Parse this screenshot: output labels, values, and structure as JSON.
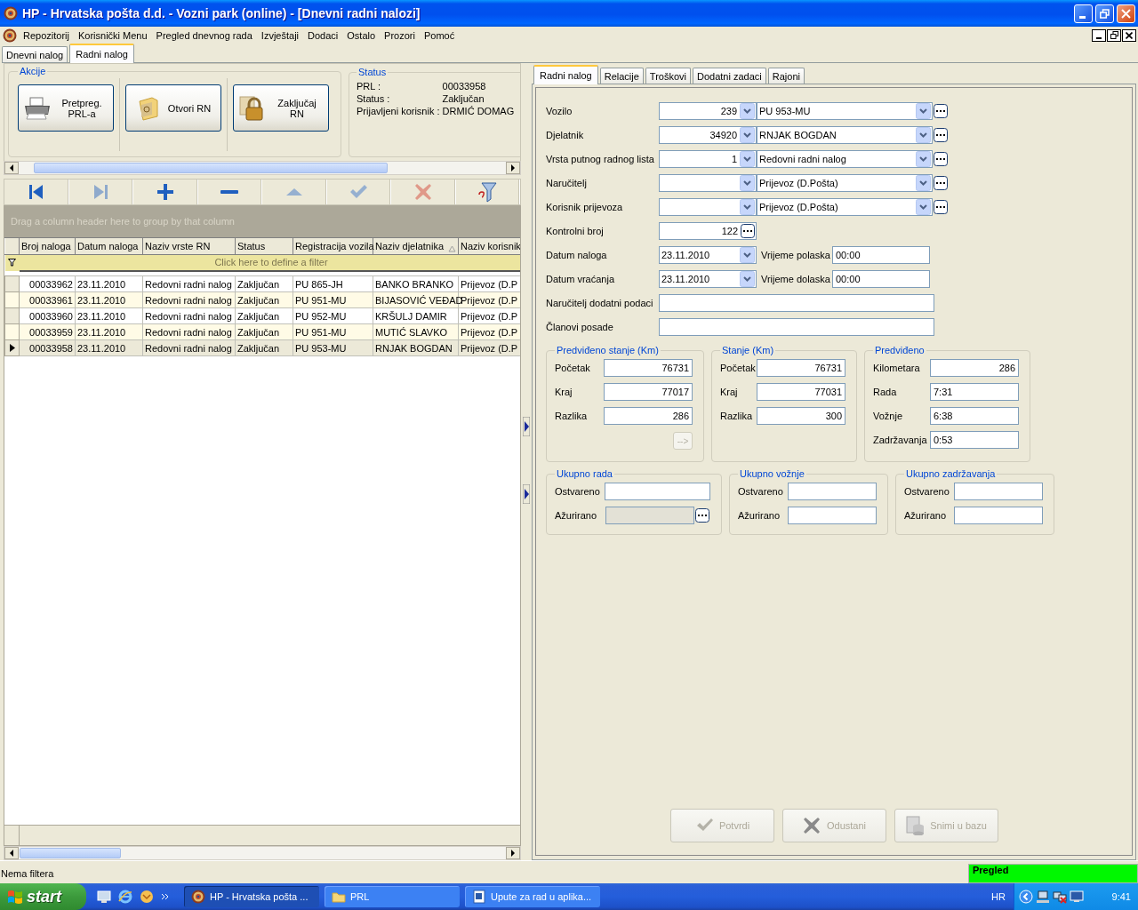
{
  "window": {
    "title": "HP - Hrvatska pošta d.d. - Vozni park (online) - [Dnevni radni nalozi]"
  },
  "menu": [
    "Repozitorij",
    "Korisnički Menu",
    "Pregled dnevnog rada",
    "Izvještaji",
    "Dodaci",
    "Ostalo",
    "Prozori",
    "Pomoć"
  ],
  "page_tabs": [
    {
      "label": "Dnevni nalog",
      "selected": false
    },
    {
      "label": "Radni nalog",
      "selected": true
    }
  ],
  "actions": {
    "title": "Akcije",
    "buttons": [
      {
        "label": "Pretpreg. PRL-a",
        "kind": "printer"
      },
      {
        "label": "Otvori RN",
        "kind": "folder"
      },
      {
        "label": "Zaključaj RN",
        "kind": "lock"
      }
    ]
  },
  "status": {
    "title": "Status",
    "rows": [
      {
        "label": "PRL :",
        "value": "00033958"
      },
      {
        "label": "Status :",
        "value": "Zaključan"
      },
      {
        "label": "Prijavljeni korisnik :",
        "value": "DRMIĆ DOMAG"
      }
    ]
  },
  "navigator": [
    {
      "kind": "first",
      "disabled": false
    },
    {
      "kind": "last",
      "disabled": true
    },
    {
      "kind": "add",
      "disabled": false
    },
    {
      "kind": "remove",
      "disabled": false
    },
    {
      "kind": "up",
      "disabled": true
    },
    {
      "kind": "confirm",
      "disabled": true
    },
    {
      "kind": "cancel",
      "disabled": true
    },
    {
      "kind": "filter",
      "disabled": false
    }
  ],
  "grid": {
    "group_hint": "Drag a column header here to group by that column",
    "filter_hint": "Click here to define a filter",
    "columns": [
      {
        "label": "Broj naloga",
        "sorted": false
      },
      {
        "label": "Datum naloga",
        "sorted": false
      },
      {
        "label": "Naziv vrste RN",
        "sorted": false
      },
      {
        "label": "Status",
        "sorted": false
      },
      {
        "label": "Registracija vozila",
        "sorted": false
      },
      {
        "label": "Naziv djelatnika",
        "sorted": true
      },
      {
        "label": "Naziv korisnik",
        "sorted": false
      }
    ],
    "rows": [
      {
        "selected": false,
        "cells": [
          "00033962",
          "23.11.2010",
          "Redovni radni nalog",
          "Zaključan",
          "PU 865-JH",
          "BANKO BRANKO",
          "Prijevoz (D.P"
        ]
      },
      {
        "selected": false,
        "cells": [
          "00033961",
          "23.11.2010",
          "Redovni radni nalog",
          "Zaključan",
          "PU 951-MU",
          "BIJASOVIĆ VEĐAD",
          "Prijevoz (D.P"
        ]
      },
      {
        "selected": false,
        "cells": [
          "00033960",
          "23.11.2010",
          "Redovni radni nalog",
          "Zaključan",
          "PU 952-MU",
          "KRŠULJ DAMIR",
          "Prijevoz (D.P"
        ]
      },
      {
        "selected": false,
        "cells": [
          "00033959",
          "23.11.2010",
          "Redovni radni nalog",
          "Zaključan",
          "PU 951-MU",
          "MUTIĆ SLAVKO",
          "Prijevoz (D.P"
        ]
      },
      {
        "selected": true,
        "cells": [
          "00033958",
          "23.11.2010",
          "Redovni radni nalog",
          "Zaključan",
          "PU 953-MU",
          "RNJAK BOGDAN",
          "Prijevoz (D.P"
        ]
      }
    ]
  },
  "detail_tabs": [
    {
      "label": "Radni nalog",
      "selected": true
    },
    {
      "label": "Relacije",
      "selected": false
    },
    {
      "label": "Troškovi",
      "selected": false
    },
    {
      "label": "Dodatni zadaci",
      "selected": false
    },
    {
      "label": "Rajoni",
      "selected": false
    }
  ],
  "form": [
    {
      "kind": "combo_pair",
      "label": "Vozilo",
      "code": "239",
      "name": "PU 953-MU"
    },
    {
      "kind": "combo_pair",
      "label": "Djelatnik",
      "code": "34920",
      "name": "RNJAK BOGDAN"
    },
    {
      "kind": "combo_pair",
      "label": "Vrsta putnog radnog lista",
      "code": "1",
      "name": "Redovni radni nalog"
    },
    {
      "kind": "combo_pair",
      "label": "Naručitelj",
      "name": "Prijevoz (D.Pošta)"
    },
    {
      "kind": "combo_pair",
      "label": "Korisnik prijevoza",
      "name": "Prijevoz (D.Pošta)"
    },
    {
      "kind": "field_button",
      "label": "Kontrolni broj",
      "value": "122"
    },
    {
      "kind": "date_time",
      "label": "Datum naloga",
      "date": "23.11.2010",
      "time_label": "Vrijeme polaska",
      "time": "00:00"
    },
    {
      "kind": "date_time",
      "label": "Datum vraćanja",
      "date": "23.11.2010",
      "time_label": "Vrijeme dolaska",
      "time": "00:00"
    },
    {
      "kind": "text",
      "label": "Naručitelj dodatni podaci"
    },
    {
      "kind": "text",
      "label": "Članovi posade"
    }
  ],
  "km_groups": [
    {
      "title": "Predviđeno stanje (Km)",
      "fields": [
        {
          "label": "Početak",
          "value": "76731",
          "kind": "number"
        },
        {
          "label": "Kraj",
          "value": "77017",
          "kind": "number"
        },
        {
          "label": "Razlika",
          "value": "286",
          "kind": "number"
        }
      ],
      "button": {
        "label": "-->",
        "disabled": true
      }
    },
    {
      "title": "Stanje (Km)",
      "fields": [
        {
          "label": "Početak",
          "value": "76731",
          "kind": "number"
        },
        {
          "label": "Kraj",
          "value": "77031",
          "kind": "number"
        },
        {
          "label": "Razlika",
          "value": "300",
          "kind": "number"
        }
      ]
    },
    {
      "title": "Predviđeno",
      "fields": [
        {
          "label": "Kilometara",
          "value": "286",
          "kind": "number"
        },
        {
          "label": "Rada",
          "value": "7:31",
          "kind": "time"
        },
        {
          "label": "Vožnje",
          "value": "6:38",
          "kind": "time"
        },
        {
          "label": "Zadržavanja",
          "value": "0:53",
          "kind": "time"
        }
      ]
    }
  ],
  "total_groups": [
    {
      "title": "Ukupno rada",
      "fields": [
        {
          "label": "Ostvareno",
          "disabled": false,
          "kind": "plain"
        },
        {
          "label": "Ažurirano",
          "disabled": true,
          "kind": "with_button"
        }
      ]
    },
    {
      "title": "Ukupno vožnje",
      "fields": [
        {
          "label": "Ostvareno",
          "disabled": false,
          "kind": "plain"
        },
        {
          "label": "Ažurirano",
          "disabled": false,
          "kind": "plain"
        }
      ]
    },
    {
      "title": "Ukupno zadržavanja",
      "fields": [
        {
          "label": "Ostvareno",
          "disabled": false,
          "kind": "plain"
        },
        {
          "label": "Ažurirano",
          "disabled": false,
          "kind": "plain"
        }
      ]
    }
  ],
  "footer_buttons": [
    {
      "label": "Potvrdi",
      "kind": "check",
      "disabled": true
    },
    {
      "label": "Odustani",
      "kind": "cross",
      "disabled": true
    },
    {
      "label": "Snimi u bazu",
      "kind": "database",
      "disabled": true
    }
  ],
  "status_bar": {
    "text": "Nema filtera",
    "mode": "Pregled"
  },
  "taskbar": {
    "start": "start",
    "tasks": [
      {
        "label": "HP - Hrvatska pošta ...",
        "kind": "app",
        "selected": true
      },
      {
        "label": "PRL",
        "kind": "folder",
        "selected": false
      },
      {
        "label": "Upute za rad u aplika...",
        "kind": "document",
        "selected": false
      }
    ],
    "language": "HR",
    "clock": "9:41"
  }
}
